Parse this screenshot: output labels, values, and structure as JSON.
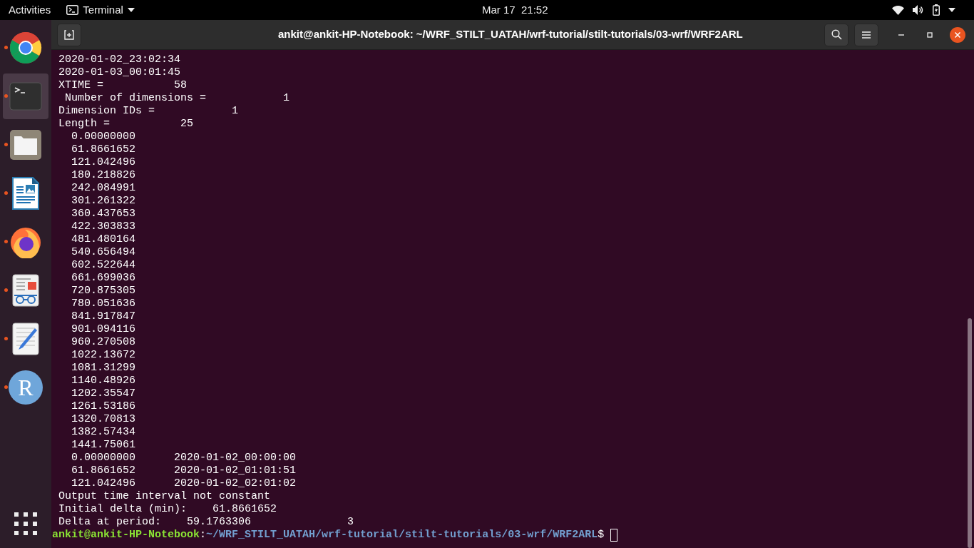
{
  "top_bar": {
    "activities": "Activities",
    "app_menu": "Terminal",
    "clock": "Mar 17  21:52"
  },
  "dock": {
    "items": [
      {
        "kind": "chrome",
        "running": true,
        "focused": false
      },
      {
        "kind": "terminal",
        "running": true,
        "focused": true
      },
      {
        "kind": "files",
        "running": true,
        "focused": false
      },
      {
        "kind": "writer",
        "running": true,
        "focused": false
      },
      {
        "kind": "firefox",
        "running": true,
        "focused": false
      },
      {
        "kind": "viewer",
        "running": true,
        "focused": false
      },
      {
        "kind": "editor",
        "running": true,
        "focused": false
      },
      {
        "kind": "r",
        "running": true,
        "focused": false,
        "letter": "R"
      }
    ]
  },
  "window": {
    "title": "ankit@ankit-HP-Notebook: ~/WRF_STILT_UATAH/wrf-tutorial/stilt-tutorials/03-wrf/WRF2ARL"
  },
  "terminal": {
    "lines": [
      " 2020-01-02_23:02:34",
      " 2020-01-03_00:01:45",
      " XTIME =           58",
      "  Number of dimensions =            1",
      " Dimension IDs =            1",
      " Length =           25",
      "   0.00000000",
      "   61.8661652",
      "   121.042496",
      "   180.218826",
      "   242.084991",
      "   301.261322",
      "   360.437653",
      "   422.303833",
      "   481.480164",
      "   540.656494",
      "   602.522644",
      "   661.699036",
      "   720.875305",
      "   780.051636",
      "   841.917847",
      "   901.094116",
      "   960.270508",
      "   1022.13672",
      "   1081.31299",
      "   1140.48926",
      "   1202.35547",
      "   1261.53186",
      "   1320.70813",
      "   1382.57434",
      "   1441.75061",
      "   0.00000000      2020-01-02_00:00:00",
      "   61.8661652      2020-01-02_01:01:51",
      "   121.042496      2020-01-02_02:01:02",
      " Output time interval not constant",
      " Initial delta (min):    61.8661652",
      " Delta at period:    59.1763306               3"
    ],
    "prompt": {
      "user_host": "ankit@ankit-HP-Notebook",
      "separator": ":",
      "path": "~/WRF_STILT_UATAH/wrf-tutorial/stilt-tutorials/03-wrf/WRF2ARL",
      "symbol": "$ "
    }
  }
}
